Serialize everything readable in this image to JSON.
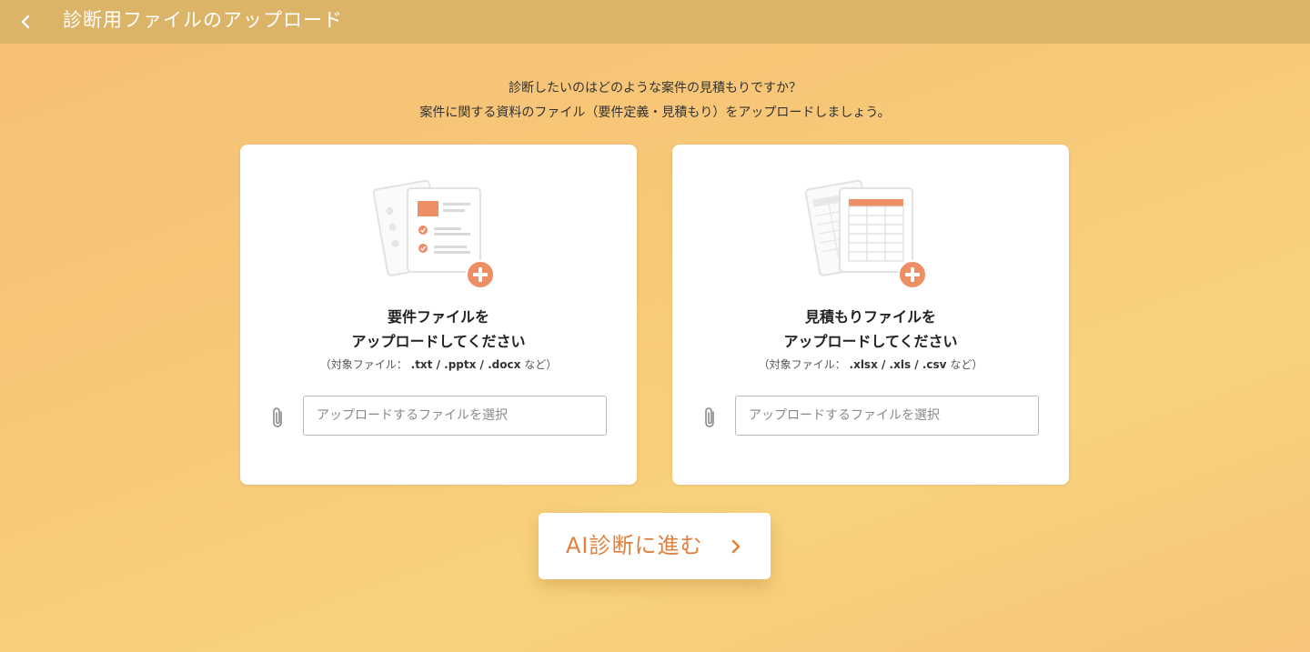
{
  "header": {
    "back_icon": "chevron-left-icon",
    "title": "診断用ファイルのアップロード"
  },
  "intro": {
    "line1": "診断したいのはどのような案件の見積もりですか？",
    "line2": "案件に関する資料のファイル（要件定義・見積もり）をアップロードしましょう。"
  },
  "cards": [
    {
      "illustration_icon": "requirements-document-add-icon",
      "heading_line1": "要件ファイルを",
      "heading_line2": "アップロードしてください",
      "note_prefix": "（対象ファイル：",
      "note_types": ".txt / .pptx / .docx",
      "note_suffix": "など）",
      "attach_icon": "paperclip-icon",
      "input_placeholder": "アップロードするファイルを選択",
      "input_value": ""
    },
    {
      "illustration_icon": "spreadsheet-add-icon",
      "heading_line1": "見積もりファイルを",
      "heading_line2": "アップロードしてください",
      "note_prefix": "（対象ファイル：",
      "note_types": ".xlsx / .xls / .csv",
      "note_suffix": "など）",
      "attach_icon": "paperclip-icon",
      "input_placeholder": "アップロードするファイルを選択",
      "input_value": ""
    }
  ],
  "cta": {
    "label": "AI診断に進む",
    "icon": "chevron-right-icon"
  },
  "colors": {
    "accent": "#e8885a",
    "cta_text": "#e07f3e",
    "topbar": "#dcb468"
  }
}
